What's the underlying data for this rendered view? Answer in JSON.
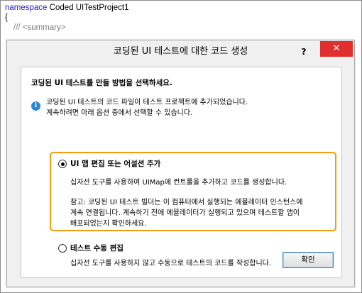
{
  "code": {
    "keyword": "namespace",
    "namespace_name": " Coded UITestProject1",
    "brace": "{",
    "comment": "/// <summary>"
  },
  "dialog": {
    "title": "코딩된 UI 테스트에 대한 코드 생성",
    "help_label": "?",
    "close_label": "✕",
    "instruction": "코딩된 UI 테스트를 만들 방법을 선택하세요.",
    "info_line1": "코딩된 UI 테스트의 코드 파일이 테스트 프로젝트에 추가되었습니다.",
    "info_line2": "계속하려면 아래 옵션 중에서 선택할 수 있습니다.",
    "option1": {
      "label": "UI 맵 편집 또는 어설션 추가",
      "selected": true,
      "desc": "십자선 도구를 사용하여 UIMap에 컨트롤을 추가하고 코드를 생성합니다.",
      "note_line1": "참고: 코딩된 UI 테스트 빌더는 이 컴퓨터에서 실행되는 에뮬레이터 인스턴스에",
      "note_line2": "계속 연결됩니다. 계속하기 전에 에뮬레이터가 실행되고 있으며 테스트할 앱이",
      "note_line3": "배포되었는지 확인하세요."
    },
    "option2": {
      "label": "테스트 수동 편집",
      "selected": false,
      "desc": "십자선 도구를 사용하지 않고 수동으로 테스트의 코드를 작성합니다."
    },
    "ok_label": "확인"
  },
  "colors": {
    "highlight_border": "#f39c12",
    "close_button": "#e0302e",
    "info_icon": "#2e86d6",
    "keyword": "#2323c8"
  }
}
